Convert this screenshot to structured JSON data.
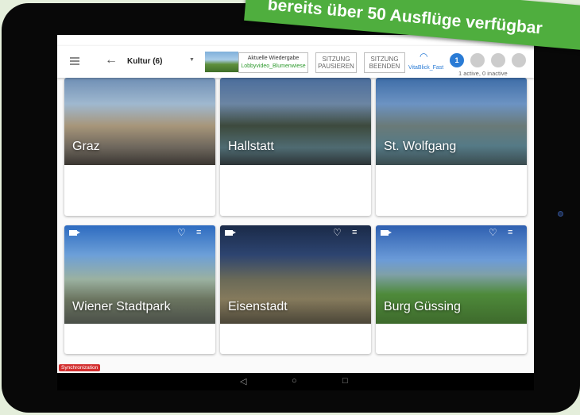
{
  "banner": {
    "text": "bereits über 50 Ausflüge verfügbar"
  },
  "appbar": {
    "category": "Kultur (6)",
    "playback_label": "Aktuelle Wiedergabe",
    "playback_file": "Lobbyvideo_Blumenwiese",
    "pause_label": "SITZUNG PAUSIEREN",
    "end_label": "SITZUNG BEENDEN",
    "network": "VitaBlick_Fast",
    "device_count": "1",
    "device_status": "1 active, 0 inactive"
  },
  "cards": [
    {
      "title": "Graz"
    },
    {
      "title": "Hallstatt"
    },
    {
      "title": "St. Wolfgang"
    },
    {
      "title": "Wiener Stadtpark"
    },
    {
      "title": "Eisenstadt"
    },
    {
      "title": "Burg Güssing"
    }
  ],
  "sync_label": "Synchronization",
  "icons": {
    "menu": "menu-icon",
    "back": "back-arrow-icon",
    "dropdown": "dropdown-icon",
    "wifi": "wifi-icon",
    "video": "video-camera-icon",
    "favorite": "heart-icon",
    "playlist": "playlist-add-icon"
  }
}
